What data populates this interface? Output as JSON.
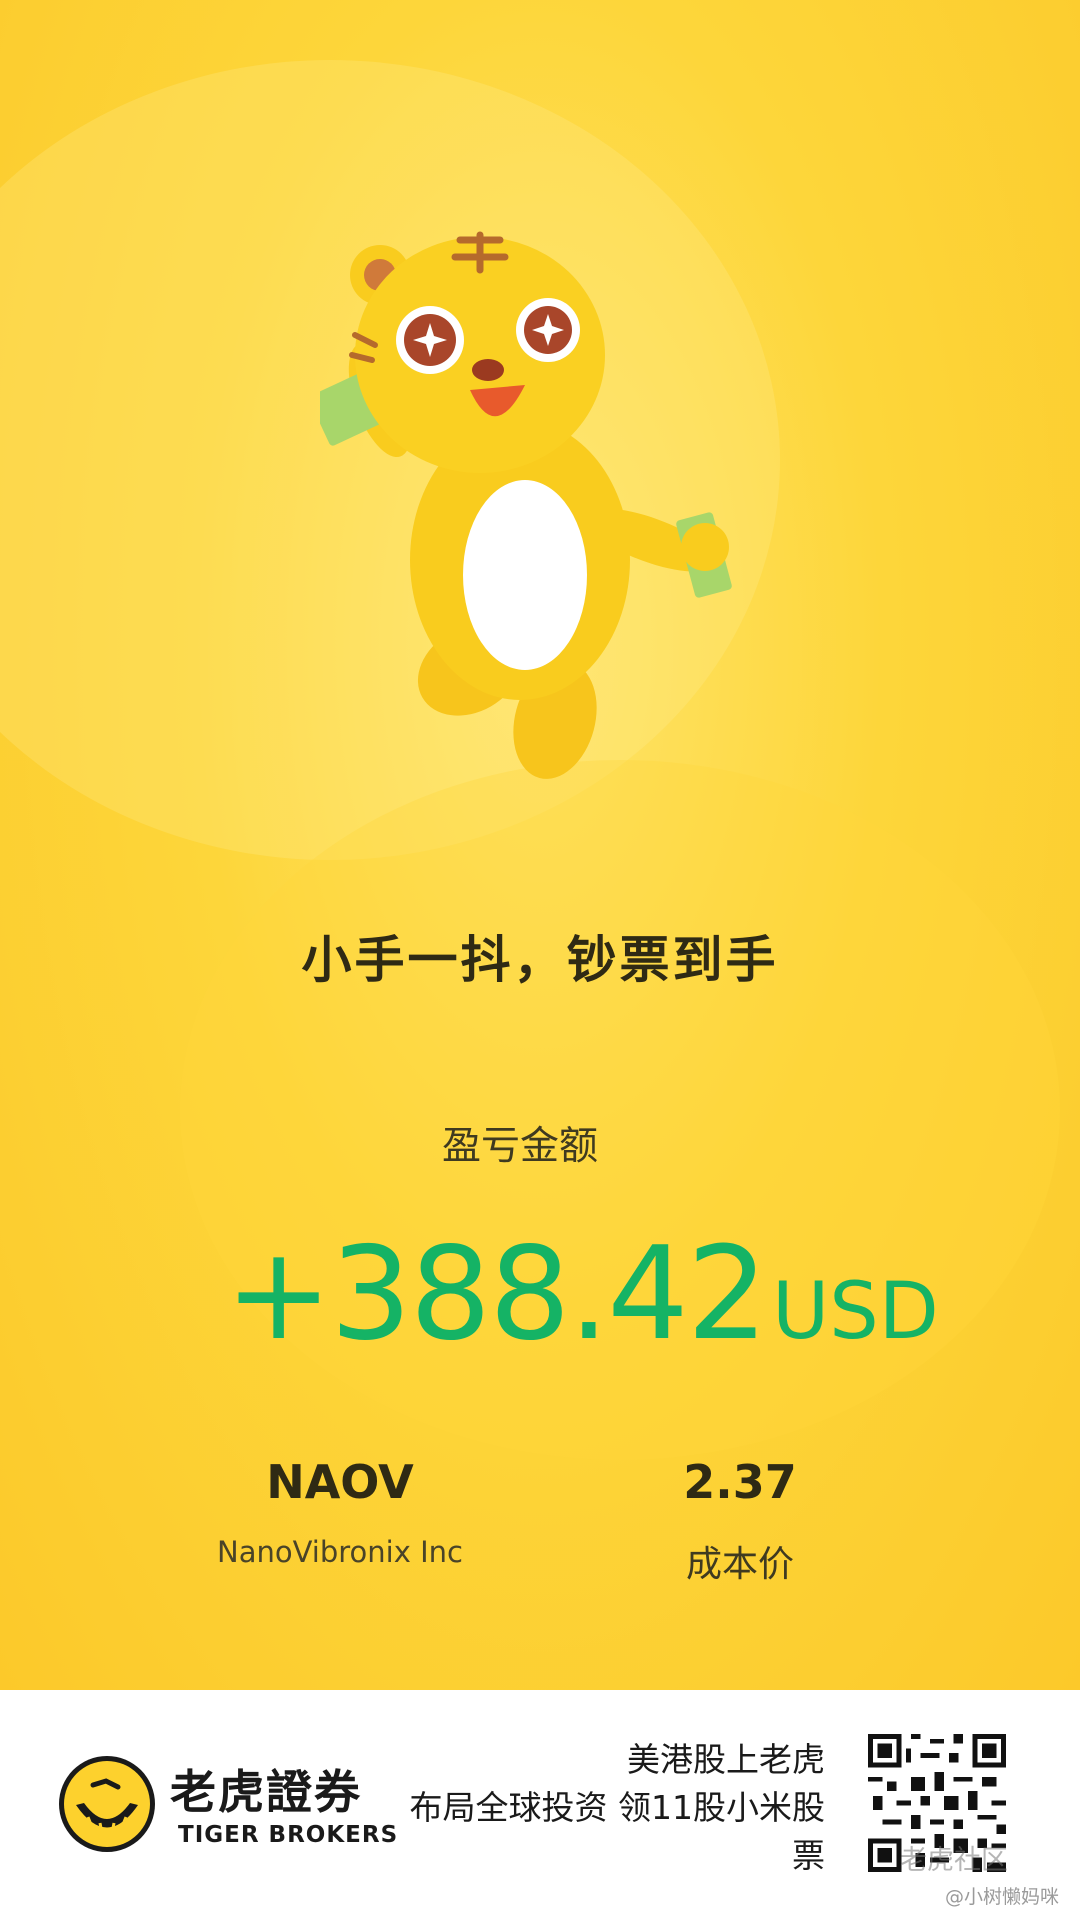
{
  "poster": {
    "slogan": "小手一抖，钞票到手",
    "pnl_label": "盈亏金额",
    "pnl_value": "+388.42",
    "pnl_currency": "USD",
    "ticker": "NAOV",
    "company": "NanoVibronix Inc",
    "price": "2.37",
    "price_label": "成本价",
    "colors": {
      "profit": "#15b365",
      "background": "#fdd63a"
    }
  },
  "footer": {
    "brand_cn": "老虎證券",
    "brand_en": "TIGER BROKERS",
    "promo_lines": [
      "美港股上老虎",
      "布局全球投资 领11股小米股",
      "票"
    ],
    "watermark_community": "老虎社区",
    "watermark_user": "@小树懒妈咪"
  },
  "icons": {
    "logo": "tiger-logo-icon",
    "mascot": "tiger-mascot",
    "qr": "qr-code"
  }
}
